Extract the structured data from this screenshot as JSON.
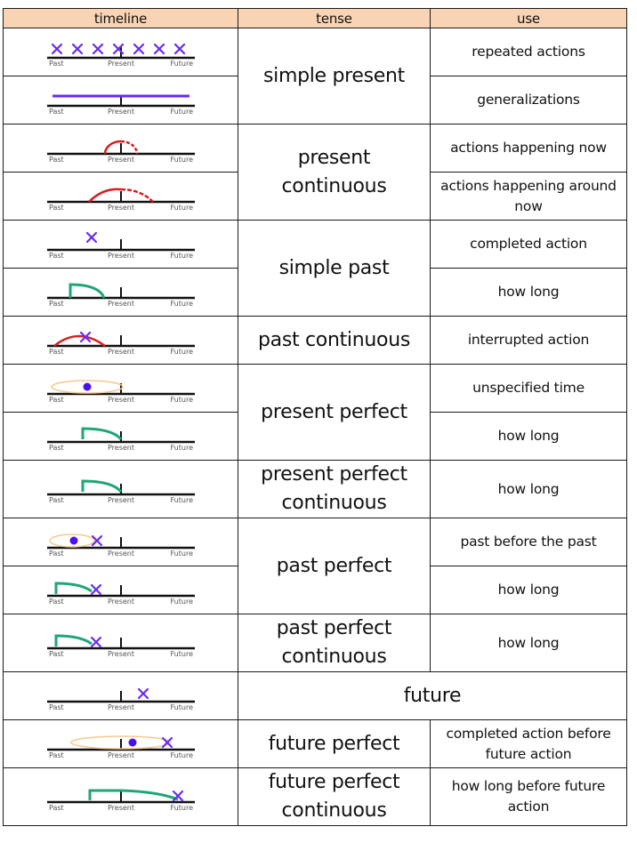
{
  "header": {
    "timeline": "timeline",
    "tense": "tense",
    "use": "use"
  },
  "axis_labels": {
    "past": "Past",
    "present": "Present",
    "future": "Future"
  },
  "colors": {
    "header_bg": "#F9D4B4",
    "mark_x": "#6A2BF0",
    "continuous_arc": "#D42020",
    "perfect_line": "#1FA57A",
    "range_ellipse": "#F3C98F",
    "dot": "#4B10F0"
  },
  "rows": [
    {
      "timeline": "repeated-x-marks",
      "use": "repeated actions"
    },
    {
      "timeline": "continuous-bar",
      "use": "generalizations"
    },
    {
      "timeline": "small-arc-around-present",
      "use": "actions happening now"
    },
    {
      "timeline": "wide-arc-around-present",
      "use": "actions happening around now"
    },
    {
      "timeline": "x-in-past",
      "use": "completed action"
    },
    {
      "timeline": "curve-ending-in-past",
      "use": "how long"
    },
    {
      "timeline": "arc-with-x-in-past",
      "use": "interrupted action"
    },
    {
      "timeline": "ellipse-dot-past",
      "use": "unspecified time"
    },
    {
      "timeline": "curve-to-present",
      "use": "how long"
    },
    {
      "timeline": "curve-to-present",
      "use": "how long"
    },
    {
      "timeline": "ellipse-dot-x-past",
      "use": "past before the past"
    },
    {
      "timeline": "curve-to-x-past",
      "use": "how long"
    },
    {
      "timeline": "curve-to-x-past",
      "use": "how long"
    },
    {
      "timeline": "x-in-future",
      "use": ""
    },
    {
      "timeline": "ellipse-dot-x-future",
      "use": "completed action before future action"
    },
    {
      "timeline": "curve-to-x-future",
      "use": "how long before future action"
    }
  ],
  "tenses": {
    "simple_present": "simple present",
    "present_continuous": "present continuous",
    "simple_past": "simple past",
    "past_continuous": "past continuous",
    "present_perfect": "present perfect",
    "present_perfect_continuous": "present perfect continuous",
    "past_perfect": "past perfect",
    "past_perfect_continuous": "past perfect continuous",
    "future": "future",
    "future_perfect": "future perfect",
    "future_perfect_continuous": "future perfect continuous"
  }
}
